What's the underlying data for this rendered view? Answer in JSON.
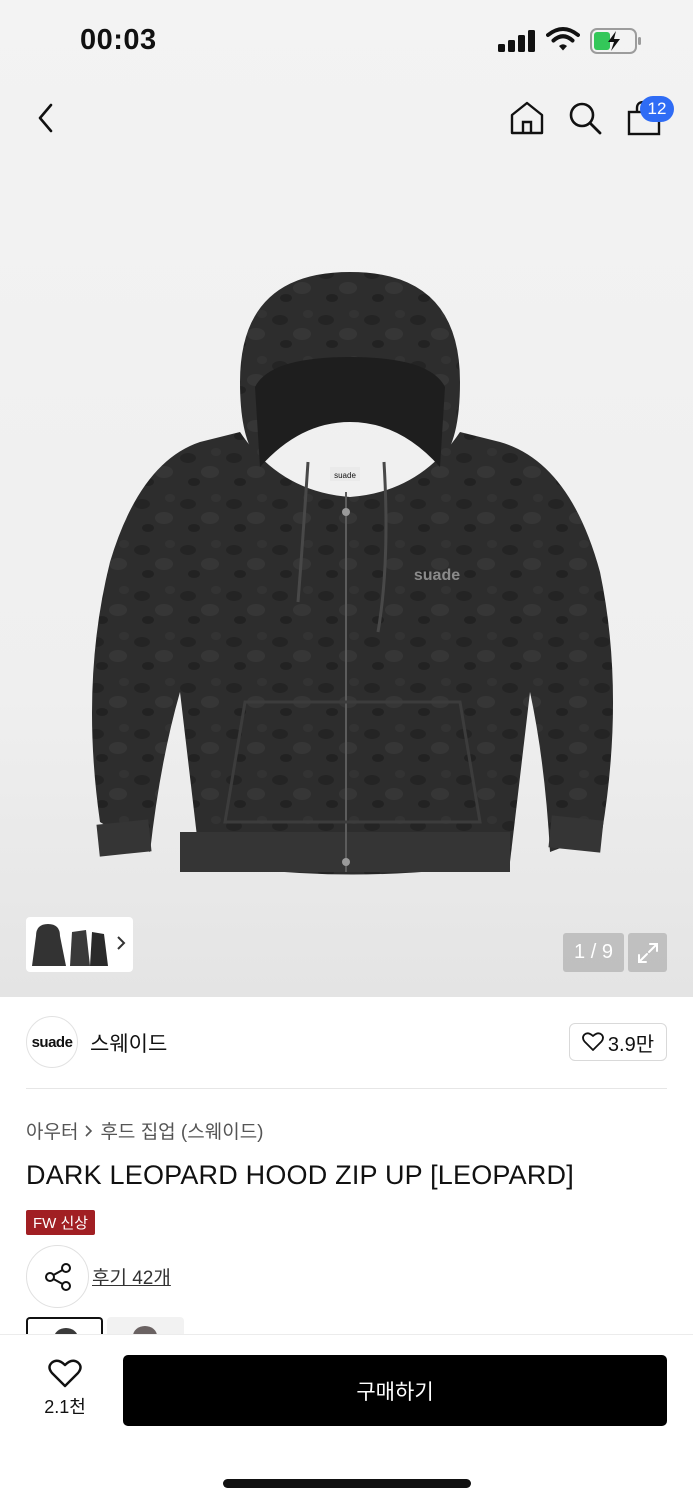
{
  "status_bar": {
    "time": "00:03",
    "icons": [
      "signal-icon",
      "wifi-icon",
      "battery-charging-icon"
    ]
  },
  "nav": {
    "icons": [
      "back-icon",
      "home-icon",
      "search-icon",
      "cart-icon"
    ],
    "cart_badge": "12"
  },
  "gallery": {
    "counter": "1 / 9",
    "product_image_icon": "hoodie-photo",
    "brand_print": "suade",
    "colors": {
      "hoodie": "#2b2b2b",
      "hoodie_dark": "#1e1e1e",
      "background": "#efefef",
      "accent": "#2f6cf5",
      "tag": "#a11f23"
    }
  },
  "brand": {
    "logo_text": "suade",
    "name": "스웨이드",
    "likes": "3.9만"
  },
  "breadcrumb": {
    "category": "아우터",
    "subcategory": "후드 집업 (스웨이드)"
  },
  "product": {
    "title": "DARK LEOPARD HOOD ZIP UP [LEOPARD]",
    "tag": "FW 신상",
    "review_link": "후기 42개"
  },
  "bottom_bar": {
    "wish_count": "2.1천",
    "buy_label": "구매하기"
  }
}
